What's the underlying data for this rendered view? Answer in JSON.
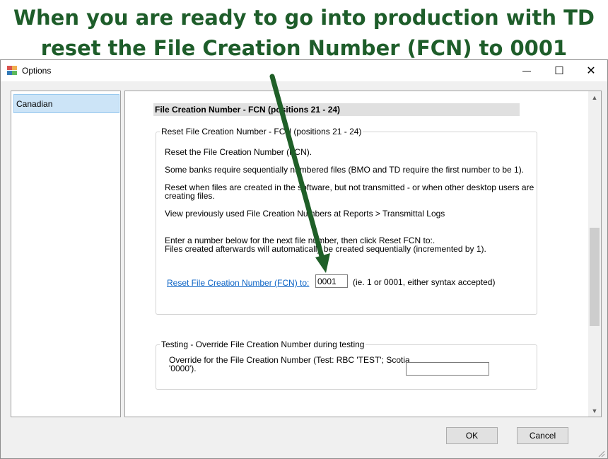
{
  "headline": {
    "line1": "When you are ready to go into production with TD",
    "line2": "reset the File Creation Number (FCN) to 0001"
  },
  "window": {
    "title": "Options",
    "minimize_glyph": "—",
    "maximize_glyph": "☐",
    "close_glyph": "✕"
  },
  "sidebar": {
    "items": [
      {
        "label": "Canadian",
        "selected": true
      }
    ]
  },
  "section": {
    "header": "File Creation Number - FCN (positions 21 - 24)"
  },
  "reset_group": {
    "title": "Reset File Creation Number - FCN (positions 21 - 24)",
    "para1": "Reset the File Creation Number (FCN).",
    "para2": "Some banks require sequentially numbered files (BMO and TD require the first number to be 1).",
    "para3_line1": "Reset when files are created in the software, but not transmitted - or when other desktop users are",
    "para3_line2": "creating files.",
    "para4": "View previously used File Creation Numbers at Reports > Transmittal Logs",
    "para5_line1": "Enter a number below for the next file number, then click Reset FCN to:.",
    "para5_line2": "Files created afterwards will automatically be created sequentially (incremented by 1).",
    "reset_link": "Reset File Creation Number (FCN) to:",
    "fcn_value": "0001",
    "fcn_hint": "(ie. 1 or 0001, either syntax accepted)"
  },
  "testing_group": {
    "title": "Testing - Override File Creation Number during testing",
    "label_line1": "Override for the File Creation Number (Test: RBC 'TEST'; Scotia",
    "label_line2": "'0000').",
    "override_value": ""
  },
  "buttons": {
    "ok": "OK",
    "cancel": "Cancel"
  },
  "colors": {
    "headline": "#1e5d2a",
    "arrow": "#1f5f28",
    "link": "#0b63c5",
    "selection": "#cce4f7"
  }
}
